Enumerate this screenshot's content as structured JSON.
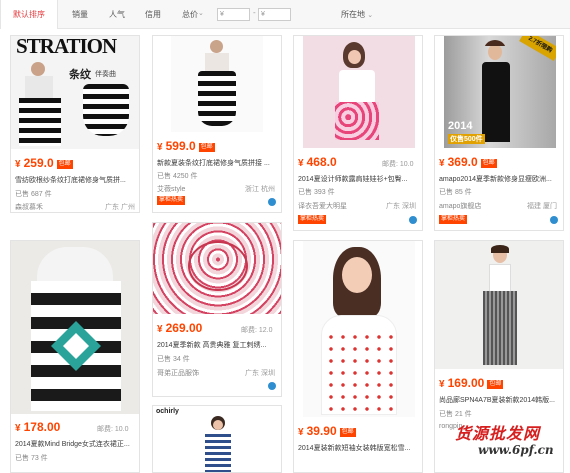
{
  "sortbar": {
    "tabs": [
      "默认排序",
      "销量",
      "人气",
      "信用",
      "总价"
    ],
    "price_from": "¥",
    "price_to": "¥",
    "dash": "-",
    "location": "所在地"
  },
  "watermark": {
    "main": "货源批发网",
    "url": "www.6pf.cn"
  },
  "cards": [
    {
      "headline": "STRATION",
      "sub": "条纹",
      "sub2": "伴奏曲",
      "price": "259.0",
      "badge": "包邮",
      "postage": "",
      "title": "雪纺欧根纱条纹打底裙修身气质拼...",
      "sold": "已售 687 件",
      "shop": "森叔慕禾",
      "loc": "广东 广州",
      "tag": ""
    },
    {
      "headline": "",
      "price": "599.0",
      "badge": "包邮",
      "postage": "",
      "title": "新款夏装条纹打底裙修身气质拼接 ...",
      "sold": "已售 4250 件",
      "shop": "艾薇style",
      "loc": "浙江 杭州",
      "tag": "掌柜热卖"
    },
    {
      "headline": "",
      "price": "468.0",
      "badge": "",
      "postage": "邮费: 10.0",
      "title": "2014夏设计师款露肩娃娃衫+包臀...",
      "sold": "已售 393 件",
      "shop": "译衣吾爱大明星",
      "loc": "广东 深圳",
      "tag": "掌柜热卖"
    },
    {
      "headline": "",
      "ribbon": "2.7折限购",
      "stamp": "2014",
      "stamp2": "仅售500件",
      "price": "369.0",
      "badge": "包邮",
      "postage": "",
      "title": "amapo2014夏季新款修身显瘦欧洲...",
      "sold": "已售 85 件",
      "shop": "amapo旗舰店",
      "loc": "福建 厦门",
      "tag": "掌柜热卖"
    },
    {
      "headline": "",
      "price": "178.00",
      "badge": "",
      "postage": "邮费: 10.0",
      "title": "2014夏款Mind Bridge女式连衣裙正...",
      "sold": "已售 73 件",
      "shop": "",
      "loc": "",
      "tag": ""
    },
    {
      "headline": "",
      "price": "269.00",
      "badge": "",
      "postage": "邮费: 12.0",
      "title": "2014夏季新款 高贵典雅 复工刺绣...",
      "sold": "已售 34 件",
      "shop": "哥弟正品服饰",
      "loc": "广东 深圳",
      "tag": ""
    },
    {
      "headline": "",
      "price": "39.90",
      "badge": "包邮",
      "postage": "",
      "title": "2014夏装新款短袖女装韩版宽松雪...",
      "sold": "",
      "shop": "",
      "loc": "",
      "tag": ""
    },
    {
      "headline": "",
      "price": "169.00",
      "badge": "包邮",
      "postage": "",
      "title": "尚品廊SPN4A7B夏装新款2014韩版...",
      "sold": "已售 21 件",
      "shop": "rongpin...",
      "loc": "",
      "tag": ""
    },
    {
      "headline": "ochirly",
      "price": "",
      "badge": "",
      "postage": "",
      "title": "",
      "sold": "",
      "shop": "",
      "loc": "",
      "tag": ""
    }
  ]
}
